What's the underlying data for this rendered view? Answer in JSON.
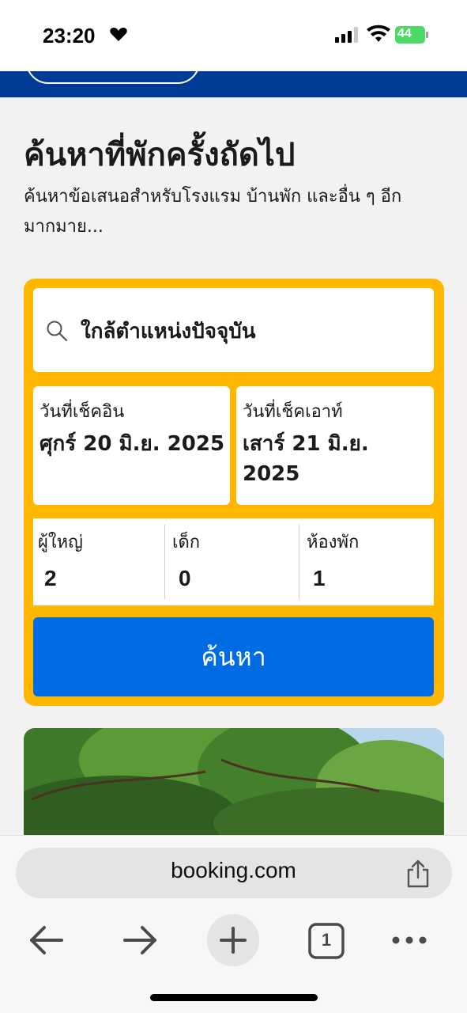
{
  "status_bar": {
    "time": "23:20",
    "battery": "44"
  },
  "hero": {
    "title": "ค้นหาที่พักครั้งถัดไป",
    "subtitle": "ค้นหาข้อเสนอสำหรับโรงแรม บ้านพัก และอื่น ๆ อีกมากมาย..."
  },
  "search": {
    "destination": "ใกล้ตำแหน่งปัจจุบัน",
    "checkin_label": "วันที่เช็คอิน",
    "checkin_value": "ศุกร์ 20 มิ.ย. 2025",
    "checkout_label": "วันที่เช็คเอาท์",
    "checkout_value": "เสาร์ 21 มิ.ย. 2025",
    "adults_label": "ผู้ใหญ่",
    "adults_value": "2",
    "children_label": "เด็ก",
    "children_value": "0",
    "rooms_label": "ห้องพัก",
    "rooms_value": "1",
    "button_label": "ค้นหา"
  },
  "browser": {
    "url": "booking.com",
    "tab_count": "1"
  },
  "colors": {
    "header_blue": "#003b95",
    "search_yellow": "#ffb700",
    "button_blue": "#006ce4"
  },
  "icons": [
    "heart-icon",
    "signal-icon",
    "wifi-icon",
    "battery-icon",
    "search-icon",
    "share-icon",
    "back-arrow-icon",
    "forward-arrow-icon",
    "plus-icon",
    "tabs-icon",
    "more-icon"
  ]
}
